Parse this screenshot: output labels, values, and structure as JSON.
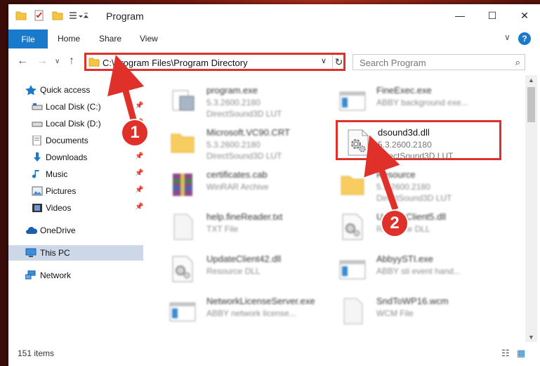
{
  "window": {
    "title": "Program",
    "minimize": "—",
    "maximize": "☐",
    "close": "✕"
  },
  "ribbon": {
    "tabs": [
      "File",
      "Home",
      "Share",
      "View"
    ],
    "collapse": "∨",
    "help": "?"
  },
  "nav": {
    "back": "←",
    "forward": "→",
    "recent": "∨",
    "up": "↑",
    "address": "C:\\Program Files\\Program Directory",
    "address_dropdown": "∨",
    "refresh": "↻",
    "search_placeholder": "Search Program",
    "search_icon_glyph": "⌕"
  },
  "sidebar": {
    "items": [
      {
        "label": "Quick access",
        "icon": "star-icon",
        "pinned": false
      },
      {
        "label": "Local Disk (C:)",
        "icon": "drive-icon",
        "pinned": true
      },
      {
        "label": "Local Disk (D:)",
        "icon": "drive-icon",
        "pinned": true
      },
      {
        "label": "Documents",
        "icon": "documents-icon",
        "pinned": true
      },
      {
        "label": "Downloads",
        "icon": "download-icon",
        "pinned": true
      },
      {
        "label": "Music",
        "icon": "music-icon",
        "pinned": true
      },
      {
        "label": "Pictures",
        "icon": "pictures-icon",
        "pinned": true
      },
      {
        "label": "Videos",
        "icon": "videos-icon",
        "pinned": true
      },
      {
        "label": "OneDrive",
        "icon": "cloud-icon",
        "pinned": false
      },
      {
        "label": "This PC",
        "icon": "pc-icon",
        "pinned": false,
        "selected": true
      },
      {
        "label": "Network",
        "icon": "network-icon",
        "pinned": false
      }
    ],
    "pin_glyph": "📌"
  },
  "files": [
    {
      "name": "program.exe",
      "version": "5.3.2600.2180",
      "desc": "DirectSound3D LUT",
      "icon": "exe-icon"
    },
    {
      "name": "FineExec.exe",
      "version": "ABBY background exe...",
      "desc": "",
      "icon": "window-app-icon"
    },
    {
      "name": "Microsoft.VC90.CRT",
      "version": "5.3.2600.2180",
      "desc": "DirectSound3D LUT",
      "icon": "folder-icon"
    },
    {
      "name": "dsound3d.dll",
      "version": "5.3.2600.2180",
      "desc": "DirectSound3D LUT",
      "icon": "dll-gear-icon",
      "highlighted": true
    },
    {
      "name": "certificates.cab",
      "version": "WinRAR Archive",
      "desc": "",
      "icon": "archive-icon"
    },
    {
      "name": "Resource",
      "version": "5.3.2600.2180",
      "desc": "DirectSound3D LUT",
      "icon": "folder-icon"
    },
    {
      "name": "help.fineReader.txt",
      "version": "TXT File",
      "desc": "",
      "icon": "text-file-icon"
    },
    {
      "name": "UpdateClient5.dll",
      "version": "Resource DLL",
      "desc": "",
      "icon": "dll-gear-icon"
    },
    {
      "name": "UpdateClient42.dll",
      "version": "Resource DLL",
      "desc": "",
      "icon": "dll-gear-icon"
    },
    {
      "name": "AbbyySTI.exe",
      "version": "ABBY sti event hand...",
      "desc": "",
      "icon": "window-app-icon"
    },
    {
      "name": "NetworkLicenseServer.exe",
      "version": "ABBY network license...",
      "desc": "",
      "icon": "window-app-icon"
    },
    {
      "name": "SndToWP16.wcm",
      "version": "WCM File",
      "desc": "",
      "icon": "text-file-icon"
    }
  ],
  "status": {
    "count": "151 items"
  },
  "annotations": {
    "step1": "1",
    "step2": "2",
    "color": "#e0302a"
  }
}
